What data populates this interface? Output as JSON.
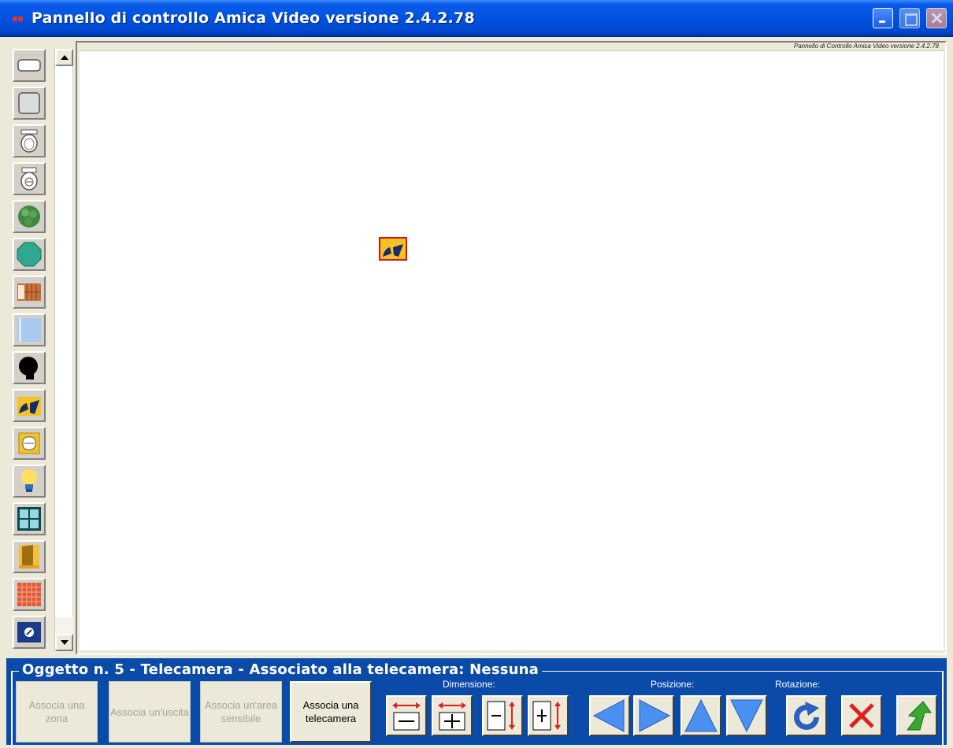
{
  "window": {
    "title": "Pannello di controllo Amica Video versione 2.4.2.78"
  },
  "canvas": {
    "caption": "Pannello di Controllo Amica Video versione 2.4.2.78"
  },
  "toolbox": {
    "items": [
      {
        "name": "rectangle-shape-tool"
      },
      {
        "name": "square-shape-tool"
      },
      {
        "name": "sink-tool"
      },
      {
        "name": "toilet-tool"
      },
      {
        "name": "plant-tool"
      },
      {
        "name": "octagon-table-tool"
      },
      {
        "name": "bookcase-tool"
      },
      {
        "name": "glass-panel-tool"
      },
      {
        "name": "speaker-tool"
      },
      {
        "name": "camera-tool"
      },
      {
        "name": "sensor-tool"
      },
      {
        "name": "light-bulb-tool"
      },
      {
        "name": "window-tool"
      },
      {
        "name": "door-tool"
      },
      {
        "name": "grid-panel-tool"
      },
      {
        "name": "badge-tool"
      }
    ]
  },
  "properties": {
    "group_title": "Oggetto n. 5 - Telecamera  - Associato alla telecamera: Nessuna",
    "buttons": {
      "associate_zone": "Associa una zona",
      "associate_output": "Associa un'uscita",
      "associate_area": "Associa un'area sensibile",
      "associate_camera": "Associa una telecamera"
    },
    "labels": {
      "dimension": "Dimensione:",
      "position": "Posizione:",
      "rotation": "Rotazione:"
    }
  },
  "colors": {
    "titlebar": "#0053e0",
    "panel": "#0a4aa8",
    "selection": "#e01010",
    "arrow_blue": "#4a90f0",
    "delete_red": "#e02020",
    "exit_green": "#3aa830"
  }
}
